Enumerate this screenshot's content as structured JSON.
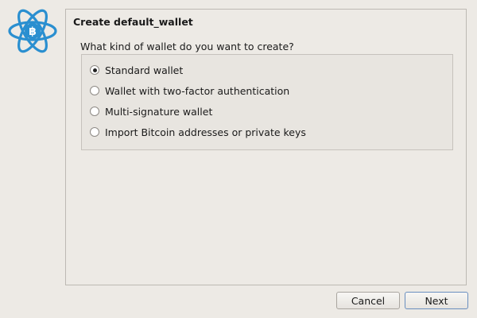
{
  "dialog": {
    "title": "Create default_wallet",
    "question": "What kind of wallet do you want to create?",
    "options": [
      {
        "label": "Standard wallet",
        "selected": true
      },
      {
        "label": "Wallet with two-factor authentication",
        "selected": false
      },
      {
        "label": "Multi-signature wallet",
        "selected": false
      },
      {
        "label": "Import Bitcoin addresses or private keys",
        "selected": false
      }
    ]
  },
  "buttons": {
    "cancel_label": "Cancel",
    "next_label": "Next"
  },
  "logo": {
    "icon": "electrum-bitcoin-atom-logo",
    "color": "#2a8fd0"
  },
  "colors": {
    "background": "#edeae5",
    "accent": "#2a8fd0"
  }
}
